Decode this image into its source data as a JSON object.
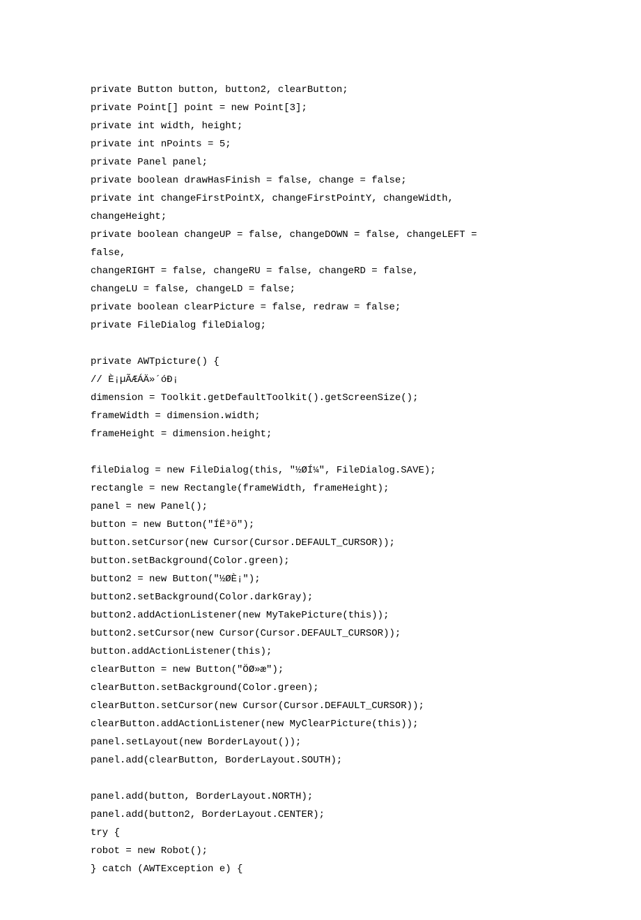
{
  "code": {
    "lines": [
      "private Button button, button2, clearButton;",
      "private Point[] point = new Point[3];",
      "private int width, height;",
      "private int nPoints = 5;",
      "private Panel panel;",
      "private boolean drawHasFinish = false, change = false;",
      "private int changeFirstPointX, changeFirstPointY, changeWidth,",
      "changeHeight;",
      "private boolean changeUP = false, changeDOWN = false, changeLEFT =",
      "false,",
      "changeRIGHT = false, changeRU = false, changeRD = false,",
      "changeLU = false, changeLD = false;",
      "private boolean clearPicture = false, redraw = false;",
      "private FileDialog fileDialog;",
      "",
      "private AWTpicture() {",
      "// È¡µÃÆÁÄ»´óÐ¡",
      "dimension = Toolkit.getDefaultToolkit().getScreenSize();",
      "frameWidth = dimension.width;",
      "frameHeight = dimension.height;",
      "",
      "fileDialog = new FileDialog(this, \"½ØÍ¼\", FileDialog.SAVE);",
      "rectangle = new Rectangle(frameWidth, frameHeight);",
      "panel = new Panel();",
      "button = new Button(\"ÍË³ö\");",
      "button.setCursor(new Cursor(Cursor.DEFAULT_CURSOR));",
      "button.setBackground(Color.green);",
      "button2 = new Button(\"½ØÈ¡\");",
      "button2.setBackground(Color.darkGray);",
      "button2.addActionListener(new MyTakePicture(this));",
      "button2.setCursor(new Cursor(Cursor.DEFAULT_CURSOR));",
      "button.addActionListener(this);",
      "clearButton = new Button(\"ÖØ»æ\");",
      "clearButton.setBackground(Color.green);",
      "clearButton.setCursor(new Cursor(Cursor.DEFAULT_CURSOR));",
      "clearButton.addActionListener(new MyClearPicture(this));",
      "panel.setLayout(new BorderLayout());",
      "panel.add(clearButton, BorderLayout.SOUTH);",
      "",
      "panel.add(button, BorderLayout.NORTH);",
      "panel.add(button2, BorderLayout.CENTER);",
      "try {",
      "robot = new Robot();",
      "} catch (AWTException e) {"
    ]
  }
}
